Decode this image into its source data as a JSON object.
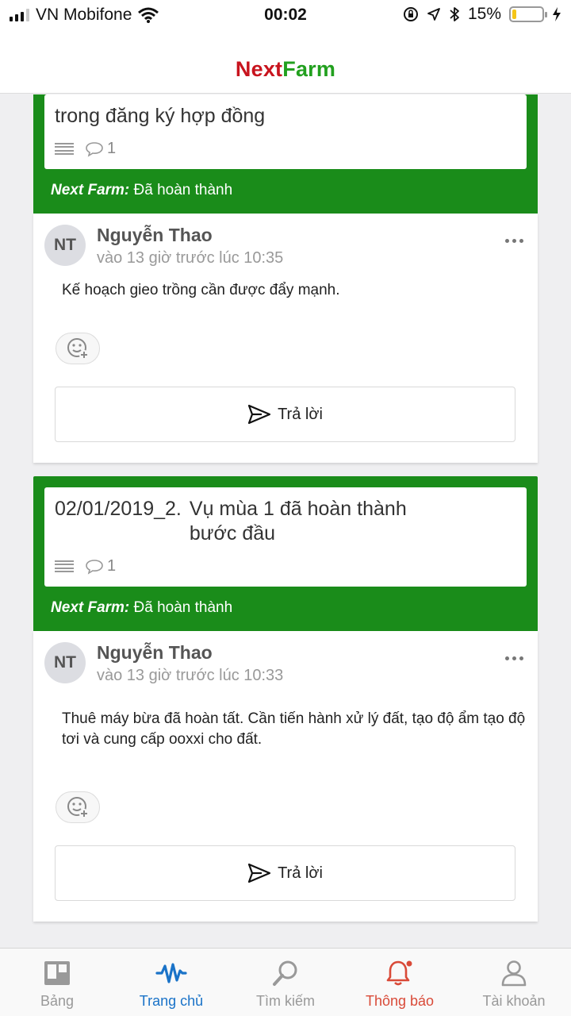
{
  "status_bar": {
    "carrier": "VN Mobifone",
    "time": "00:02",
    "battery": "15%",
    "battery_level": 0.15
  },
  "header": {
    "brand_next": "Next",
    "brand_farm": "Farm"
  },
  "posts": [
    {
      "task": {
        "title": "trong đăng ký hợp đồng",
        "comment_count": "1",
        "status_label": "Next Farm:",
        "status_value": "Đã hoàn thành"
      },
      "comment": {
        "avatar": "NT",
        "author": "Nguyễn Thao",
        "timestamp": "vào 13 giờ trước lúc 10:35",
        "body": "Kế hoạch gieo trồng cần được đẩy mạnh.",
        "reply_label": "Trả lời"
      }
    },
    {
      "task": {
        "date": "02/01/2019_2.",
        "title": "Vụ mùa 1 đã hoàn thành bước đầu",
        "comment_count": "1",
        "status_label": "Next Farm:",
        "status_value": "Đã hoàn thành"
      },
      "comment": {
        "avatar": "NT",
        "author": "Nguyễn Thao",
        "timestamp": "vào 13 giờ trước lúc 10:33",
        "body": "Thuê máy bừa đã hoàn tất. Cần tiến hành xử lý đất, tạo độ ẩm tạo độ tơi và cung cấp ooxxi cho đất.",
        "reply_label": "Trả lời"
      }
    }
  ],
  "tabs": [
    {
      "label": "Bảng",
      "icon": "board-icon"
    },
    {
      "label": "Trang chủ",
      "icon": "activity-icon"
    },
    {
      "label": "Tìm kiếm",
      "icon": "search-icon"
    },
    {
      "label": "Thông báo",
      "icon": "bell-icon"
    },
    {
      "label": "Tài khoản",
      "icon": "user-icon"
    }
  ],
  "colors": {
    "brand_red": "#c8141e",
    "brand_green": "#22a01f",
    "task_green": "#1a8c1a",
    "active_tab": "#1a73c8",
    "notification": "#d94a38"
  }
}
